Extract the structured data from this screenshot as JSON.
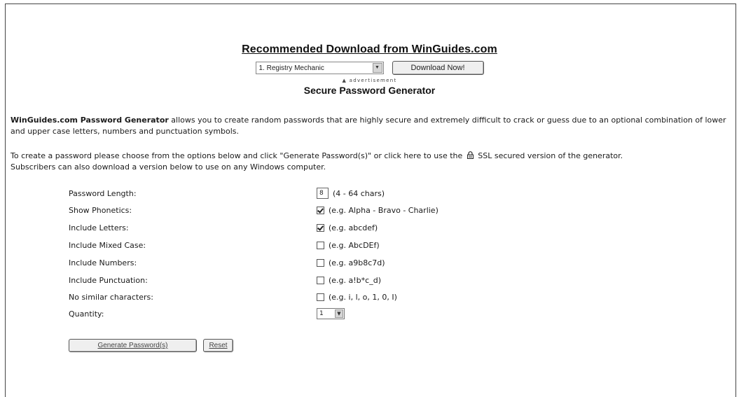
{
  "promo": {
    "title": "Recommended Download from WinGuides.com",
    "select_value": "1. Registry Mechanic",
    "download_button": "Download Now!",
    "ad_label": "▲ advertisement"
  },
  "page_title": "Secure Password Generator",
  "intro": {
    "brand": "WinGuides.com Password Generator",
    "text": " allows you to create random passwords that are highly secure and extremely difficult to crack or guess due to an optional combination of lower and upper case letters, numbers and punctuation symbols."
  },
  "instructions": {
    "part1": "To create a password please choose from the options below and click \"Generate Password(s)\" or click here to use the",
    "part2": "SSL secured version of the generator.",
    "line2": "Subscribers can also download a version below to use on any Windows computer."
  },
  "options": {
    "length": {
      "label": "Password Length:",
      "value": "8",
      "hint": "(4 - 64 chars)"
    },
    "phonetics": {
      "label": "Show Phonetics:",
      "checked": true,
      "hint": "(e.g. Alpha - Bravo - Charlie)"
    },
    "letters": {
      "label": "Include Letters:",
      "checked": true,
      "hint": "(e.g. abcdef)"
    },
    "mixed": {
      "label": "Include Mixed Case:",
      "checked": false,
      "hint": "(e.g. AbcDEf)"
    },
    "numbers": {
      "label": "Include Numbers:",
      "checked": false,
      "hint": "(e.g. a9b8c7d)"
    },
    "punctuation": {
      "label": "Include Punctuation:",
      "checked": false,
      "hint": "(e.g. a!b*c_d)"
    },
    "similar": {
      "label": "No similar characters:",
      "checked": false,
      "hint": "(e.g. i, l, o, 1, 0, I)"
    },
    "quantity": {
      "label": "Quantity:",
      "value": "1"
    }
  },
  "actions": {
    "generate": "Generate Password(s)",
    "reset": "Reset"
  }
}
